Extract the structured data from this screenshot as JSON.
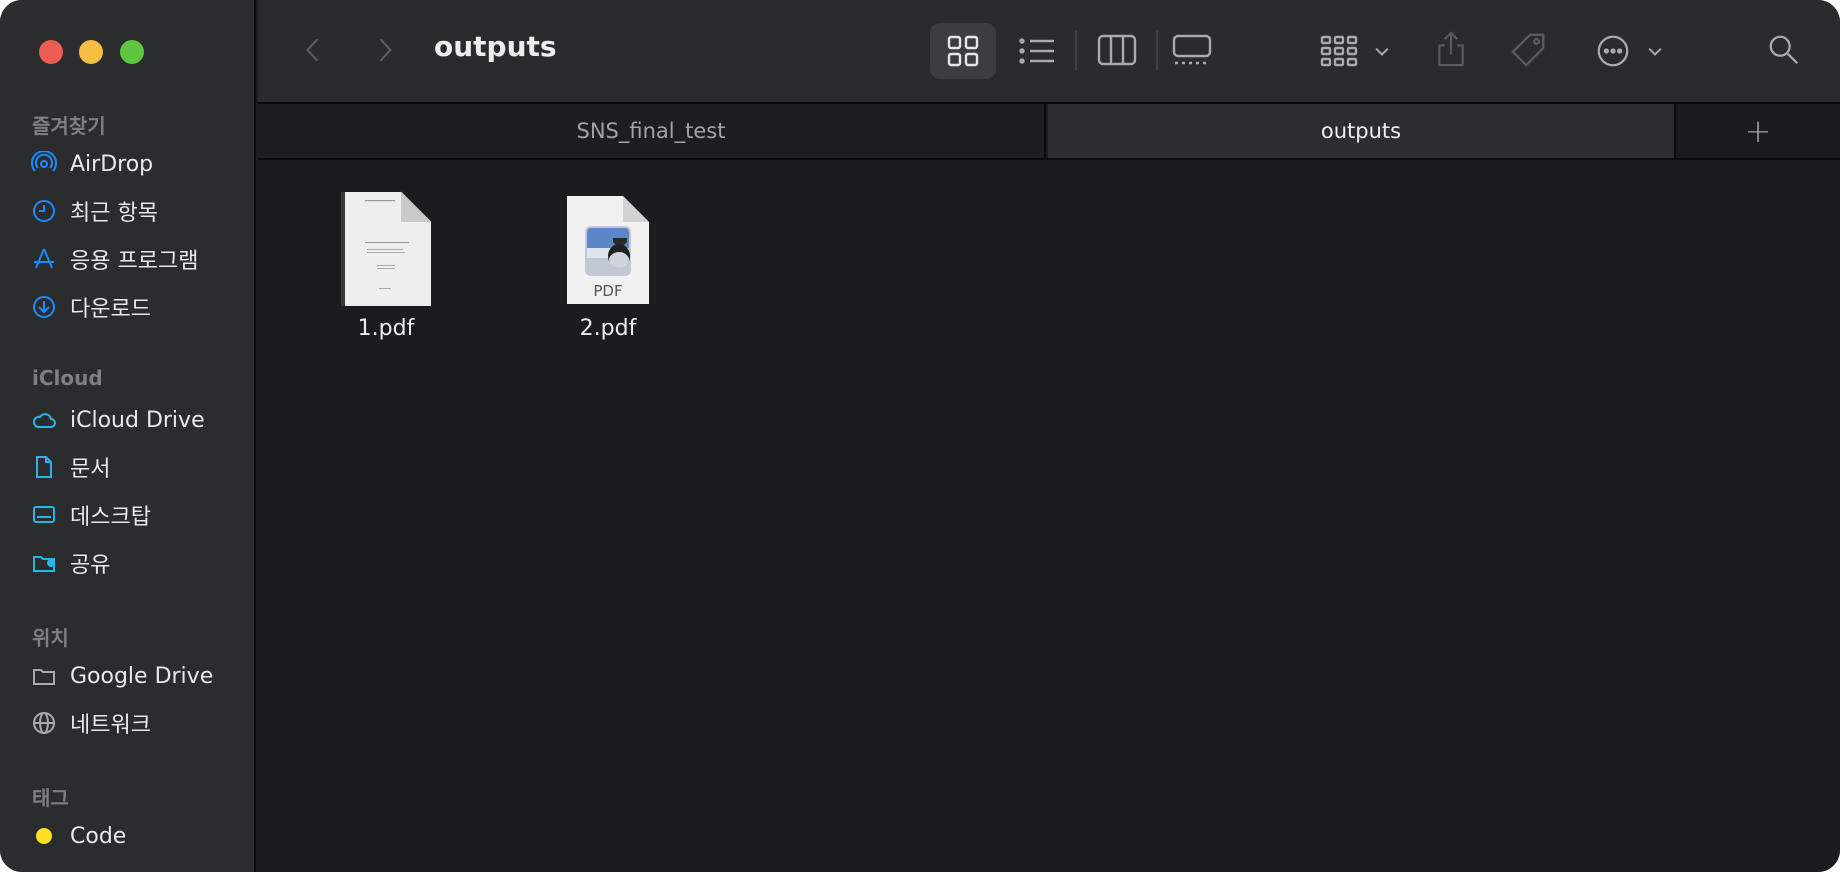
{
  "window": {
    "title": "outputs"
  },
  "sidebar": {
    "sections": [
      {
        "title": "즐겨찾기",
        "items": [
          {
            "label": "AirDrop",
            "icon": "airdrop-icon"
          },
          {
            "label": "최근 항목",
            "icon": "clock-icon"
          },
          {
            "label": "응용 프로그램",
            "icon": "applications-icon"
          },
          {
            "label": "다운로드",
            "icon": "download-icon"
          }
        ]
      },
      {
        "title": "iCloud",
        "items": [
          {
            "label": "iCloud Drive",
            "icon": "cloud-icon"
          },
          {
            "label": "문서",
            "icon": "document-icon"
          },
          {
            "label": "데스크탑",
            "icon": "desktop-icon"
          },
          {
            "label": "공유",
            "icon": "shared-folder-icon"
          }
        ]
      },
      {
        "title": "위치",
        "items": [
          {
            "label": "Google Drive",
            "icon": "folder-icon"
          },
          {
            "label": "네트워크",
            "icon": "network-icon"
          }
        ]
      },
      {
        "title": "태그",
        "items": [
          {
            "label": "Code",
            "icon": "yellow-tag-dot",
            "color": "#fbe024"
          }
        ]
      }
    ]
  },
  "tabs": [
    {
      "label": "SNS_final_test",
      "active": false
    },
    {
      "label": "outputs",
      "active": true
    }
  ],
  "files": [
    {
      "name": "1.pdf",
      "icon": "pdf-thumbnail-icon"
    },
    {
      "name": "2.pdf",
      "icon": "pdf-preview-icon",
      "badge": "PDF"
    }
  ],
  "colors": {
    "accent": "#1a8cff",
    "close": "#ed5d56",
    "minimize": "#f5bd42",
    "maximize": "#5fc641"
  }
}
